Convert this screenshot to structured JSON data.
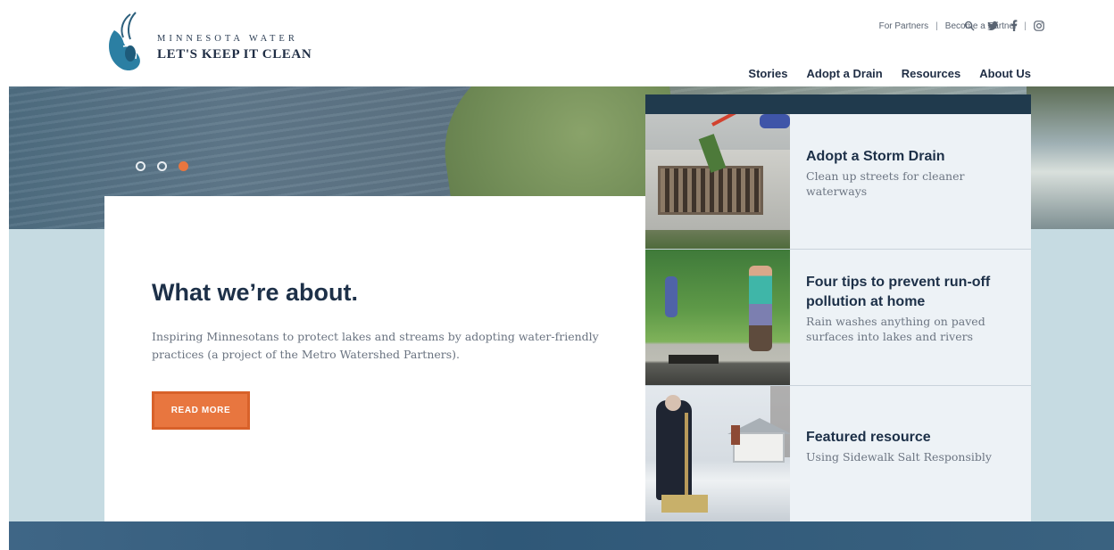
{
  "header": {
    "logo": {
      "line1": "MINNESOTA WATER",
      "line2": "LET'S KEEP IT CLEAN"
    },
    "utility_links": [
      {
        "label": "For Partners"
      },
      {
        "label": "Become a Partner"
      }
    ],
    "utility_icons": [
      "search-icon",
      "twitter-icon",
      "facebook-icon",
      "instagram-icon"
    ],
    "nav": [
      {
        "label": "Stories"
      },
      {
        "label": "Adopt a Drain"
      },
      {
        "label": "Resources"
      },
      {
        "label": "About Us"
      }
    ]
  },
  "hero": {
    "carousel": {
      "count": 3,
      "active": 3
    }
  },
  "about": {
    "title": "What we’re about.",
    "description": "Inspiring Minnesotans to protect lakes and streams by adopting water-friendly practices (a project of the Metro Watershed Partners).",
    "button_label": "READ MORE"
  },
  "features": [
    {
      "title": "Adopt a Storm Drain",
      "description": "Clean up streets for cleaner waterways"
    },
    {
      "title": "Four tips to prevent run-off pollution at home",
      "description": "Rain washes anything on paved surfaces into lakes and rivers"
    },
    {
      "title": "Featured resource",
      "description": "Using Sidewalk Salt Responsibly"
    }
  ],
  "colors": {
    "accent_orange": "#e8763f",
    "navy": "#1d3048",
    "band_light_blue": "#c6dbe2",
    "footer_blue": "#2f5878"
  }
}
